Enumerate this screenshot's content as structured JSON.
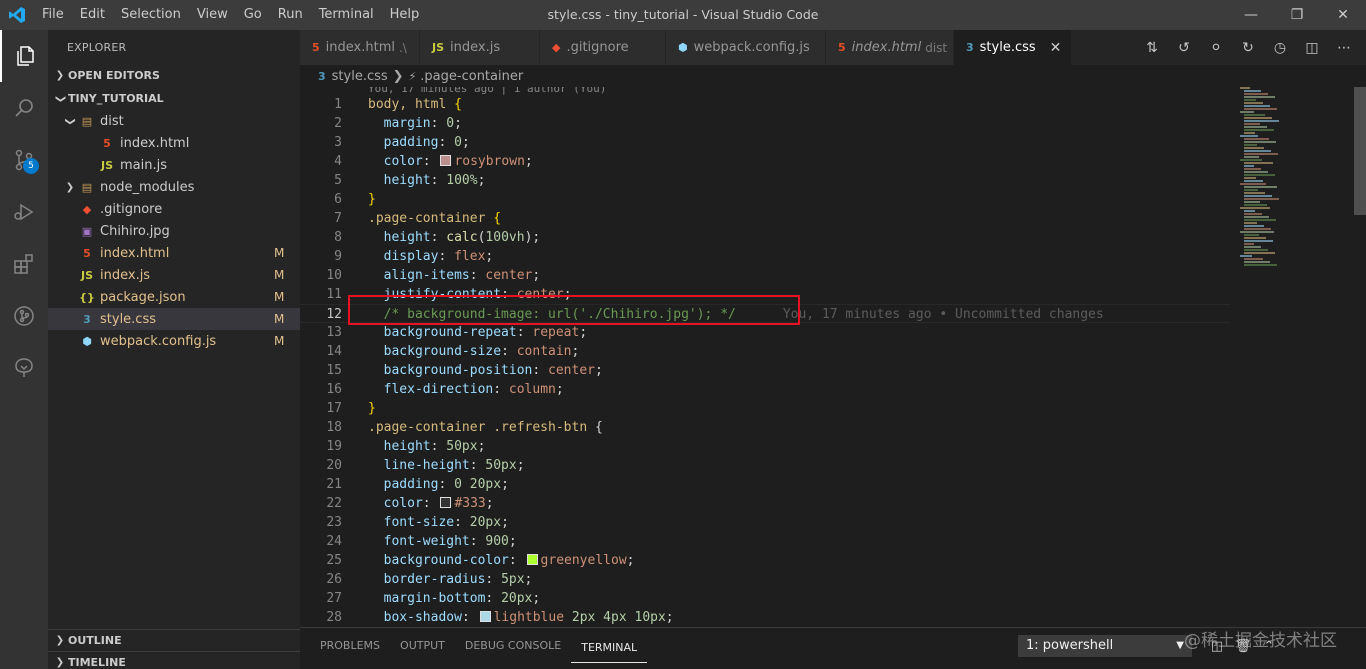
{
  "titlebar": {
    "menu": [
      "File",
      "Edit",
      "Selection",
      "View",
      "Go",
      "Run",
      "Terminal",
      "Help"
    ],
    "title": "style.css - tiny_tutorial - Visual Studio Code"
  },
  "activitybar": {
    "items": [
      {
        "name": "explorer",
        "icon": "files-icon"
      },
      {
        "name": "search",
        "icon": "search-icon"
      },
      {
        "name": "source-control",
        "icon": "source-control-icon",
        "badge": "5"
      },
      {
        "name": "run-debug",
        "icon": "debug-icon"
      },
      {
        "name": "extensions",
        "icon": "extensions-icon"
      },
      {
        "name": "git-graph",
        "icon": "git-graph-icon"
      },
      {
        "name": "remote",
        "icon": "tree-icon"
      }
    ]
  },
  "sidebar": {
    "title": "EXPLORER",
    "open_editors": "OPEN EDITORS",
    "project": "TINY_TUTORIAL",
    "tree": [
      {
        "name": "dist",
        "type": "folder",
        "depth": 1,
        "open": true,
        "git": ""
      },
      {
        "name": "index.html",
        "type": "html",
        "depth": 2,
        "git": ""
      },
      {
        "name": "main.js",
        "type": "js",
        "depth": 2,
        "git": ""
      },
      {
        "name": "node_modules",
        "type": "folder",
        "depth": 1,
        "open": false,
        "git": ""
      },
      {
        "name": ".gitignore",
        "type": "git",
        "depth": 1,
        "git": ""
      },
      {
        "name": "Chihiro.jpg",
        "type": "image",
        "depth": 1,
        "git": ""
      },
      {
        "name": "index.html",
        "type": "html",
        "depth": 1,
        "git": "M"
      },
      {
        "name": "index.js",
        "type": "js",
        "depth": 1,
        "git": "M"
      },
      {
        "name": "package.json",
        "type": "json",
        "depth": 1,
        "git": "M"
      },
      {
        "name": "style.css",
        "type": "css",
        "depth": 1,
        "git": "M",
        "selected": true
      },
      {
        "name": "webpack.config.js",
        "type": "webpack",
        "depth": 1,
        "git": "M"
      }
    ],
    "outline": "OUTLINE",
    "timeline": "TIMELINE"
  },
  "tabs": [
    {
      "label": "index.html",
      "desc": ".\\",
      "type": "html"
    },
    {
      "label": "index.js",
      "desc": "",
      "type": "js"
    },
    {
      "label": ".gitignore",
      "desc": "",
      "type": "git"
    },
    {
      "label": "webpack.config.js",
      "desc": "",
      "type": "webpack"
    },
    {
      "label": "index.html",
      "desc": "dist",
      "type": "html",
      "italic": true
    },
    {
      "label": "style.css",
      "desc": "",
      "type": "css",
      "active": true
    }
  ],
  "breadcrumb": {
    "file": "style.css",
    "symbol": ".page-container"
  },
  "editor": {
    "codelens": "You, 17 minutes ago | 1 author (You)",
    "blame": "You, 17 minutes ago • Uncommitted changes",
    "lines": [
      [
        [
          "sel",
          "body, html "
        ],
        [
          "brk",
          "{"
        ]
      ],
      [
        [
          "pun",
          "  "
        ],
        [
          "prop",
          "margin"
        ],
        [
          "pun",
          ": "
        ],
        [
          "num",
          "0"
        ],
        [
          "pun",
          ";"
        ]
      ],
      [
        [
          "pun",
          "  "
        ],
        [
          "prop",
          "padding"
        ],
        [
          "pun",
          ": "
        ],
        [
          "num",
          "0"
        ],
        [
          "pun",
          ";"
        ]
      ],
      [
        [
          "pun",
          "  "
        ],
        [
          "prop",
          "color"
        ],
        [
          "pun",
          ": "
        ],
        [
          "swatch",
          "#bc8f8f"
        ],
        [
          "val",
          "rosybrown"
        ],
        [
          "pun",
          ";"
        ]
      ],
      [
        [
          "pun",
          "  "
        ],
        [
          "prop",
          "height"
        ],
        [
          "pun",
          ": "
        ],
        [
          "num",
          "100%"
        ],
        [
          "pun",
          ";"
        ]
      ],
      [
        [
          "brk",
          "}"
        ]
      ],
      [
        [
          "sel",
          ".page-container "
        ],
        [
          "brk",
          "{"
        ]
      ],
      [
        [
          "pun",
          "  "
        ],
        [
          "prop",
          "height"
        ],
        [
          "pun",
          ": "
        ],
        [
          "fn",
          "calc"
        ],
        [
          "pun",
          "("
        ],
        [
          "num",
          "100vh"
        ],
        [
          "pun",
          ");"
        ]
      ],
      [
        [
          "pun",
          "  "
        ],
        [
          "prop",
          "display"
        ],
        [
          "pun",
          ": "
        ],
        [
          "val",
          "flex"
        ],
        [
          "pun",
          ";"
        ]
      ],
      [
        [
          "pun",
          "  "
        ],
        [
          "prop",
          "align-items"
        ],
        [
          "pun",
          ": "
        ],
        [
          "val",
          "center"
        ],
        [
          "pun",
          ";"
        ]
      ],
      [
        [
          "pun",
          "  "
        ],
        [
          "prop",
          "justify-content"
        ],
        [
          "pun",
          ": "
        ],
        [
          "val",
          "center"
        ],
        [
          "pun",
          ";"
        ]
      ],
      [
        [
          "pun",
          "  "
        ],
        [
          "cmt",
          "/* background-image: url('./Chihiro.jpg'); */"
        ]
      ],
      [
        [
          "pun",
          "  "
        ],
        [
          "prop",
          "background-repeat"
        ],
        [
          "pun",
          ": "
        ],
        [
          "val",
          "repeat"
        ],
        [
          "pun",
          ";"
        ]
      ],
      [
        [
          "pun",
          "  "
        ],
        [
          "prop",
          "background-size"
        ],
        [
          "pun",
          ": "
        ],
        [
          "val",
          "contain"
        ],
        [
          "pun",
          ";"
        ]
      ],
      [
        [
          "pun",
          "  "
        ],
        [
          "prop",
          "background-position"
        ],
        [
          "pun",
          ": "
        ],
        [
          "val",
          "center"
        ],
        [
          "pun",
          ";"
        ]
      ],
      [
        [
          "pun",
          "  "
        ],
        [
          "prop",
          "flex-direction"
        ],
        [
          "pun",
          ": "
        ],
        [
          "val",
          "column"
        ],
        [
          "pun",
          ";"
        ]
      ],
      [
        [
          "brk",
          "}"
        ]
      ],
      [
        [
          "sel",
          ".page-container .refresh-btn "
        ],
        [
          "pun",
          "{"
        ]
      ],
      [
        [
          "pun",
          "  "
        ],
        [
          "prop",
          "height"
        ],
        [
          "pun",
          ": "
        ],
        [
          "num",
          "50px"
        ],
        [
          "pun",
          ";"
        ]
      ],
      [
        [
          "pun",
          "  "
        ],
        [
          "prop",
          "line-height"
        ],
        [
          "pun",
          ": "
        ],
        [
          "num",
          "50px"
        ],
        [
          "pun",
          ";"
        ]
      ],
      [
        [
          "pun",
          "  "
        ],
        [
          "prop",
          "padding"
        ],
        [
          "pun",
          ": "
        ],
        [
          "num",
          "0 20px"
        ],
        [
          "pun",
          ";"
        ]
      ],
      [
        [
          "pun",
          "  "
        ],
        [
          "prop",
          "color"
        ],
        [
          "pun",
          ": "
        ],
        [
          "swatch",
          "#333333"
        ],
        [
          "val",
          "#333"
        ],
        [
          "pun",
          ";"
        ]
      ],
      [
        [
          "pun",
          "  "
        ],
        [
          "prop",
          "font-size"
        ],
        [
          "pun",
          ": "
        ],
        [
          "num",
          "20px"
        ],
        [
          "pun",
          ";"
        ]
      ],
      [
        [
          "pun",
          "  "
        ],
        [
          "prop",
          "font-weight"
        ],
        [
          "pun",
          ": "
        ],
        [
          "num",
          "900"
        ],
        [
          "pun",
          ";"
        ]
      ],
      [
        [
          "pun",
          "  "
        ],
        [
          "prop",
          "background-color"
        ],
        [
          "pun",
          ": "
        ],
        [
          "swatch",
          "#adff2f"
        ],
        [
          "val",
          "greenyellow"
        ],
        [
          "pun",
          ";"
        ]
      ],
      [
        [
          "pun",
          "  "
        ],
        [
          "prop",
          "border-radius"
        ],
        [
          "pun",
          ": "
        ],
        [
          "num",
          "5px"
        ],
        [
          "pun",
          ";"
        ]
      ],
      [
        [
          "pun",
          "  "
        ],
        [
          "prop",
          "margin-bottom"
        ],
        [
          "pun",
          ": "
        ],
        [
          "num",
          "20px"
        ],
        [
          "pun",
          ";"
        ]
      ],
      [
        [
          "pun",
          "  "
        ],
        [
          "prop",
          "box-shadow"
        ],
        [
          "pun",
          ": "
        ],
        [
          "swatch",
          "#add8e6"
        ],
        [
          "val",
          "lightblue"
        ],
        [
          "pun",
          " "
        ],
        [
          "num",
          "2px 4px 10px"
        ],
        [
          "pun",
          ";"
        ]
      ]
    ],
    "current_line": 12
  },
  "panel": {
    "tabs": [
      "PROBLEMS",
      "OUTPUT",
      "DEBUG CONSOLE",
      "TERMINAL"
    ],
    "active_tab": "TERMINAL",
    "terminal_select": "1: powershell"
  },
  "watermark": "@稀土掘金技术社区"
}
